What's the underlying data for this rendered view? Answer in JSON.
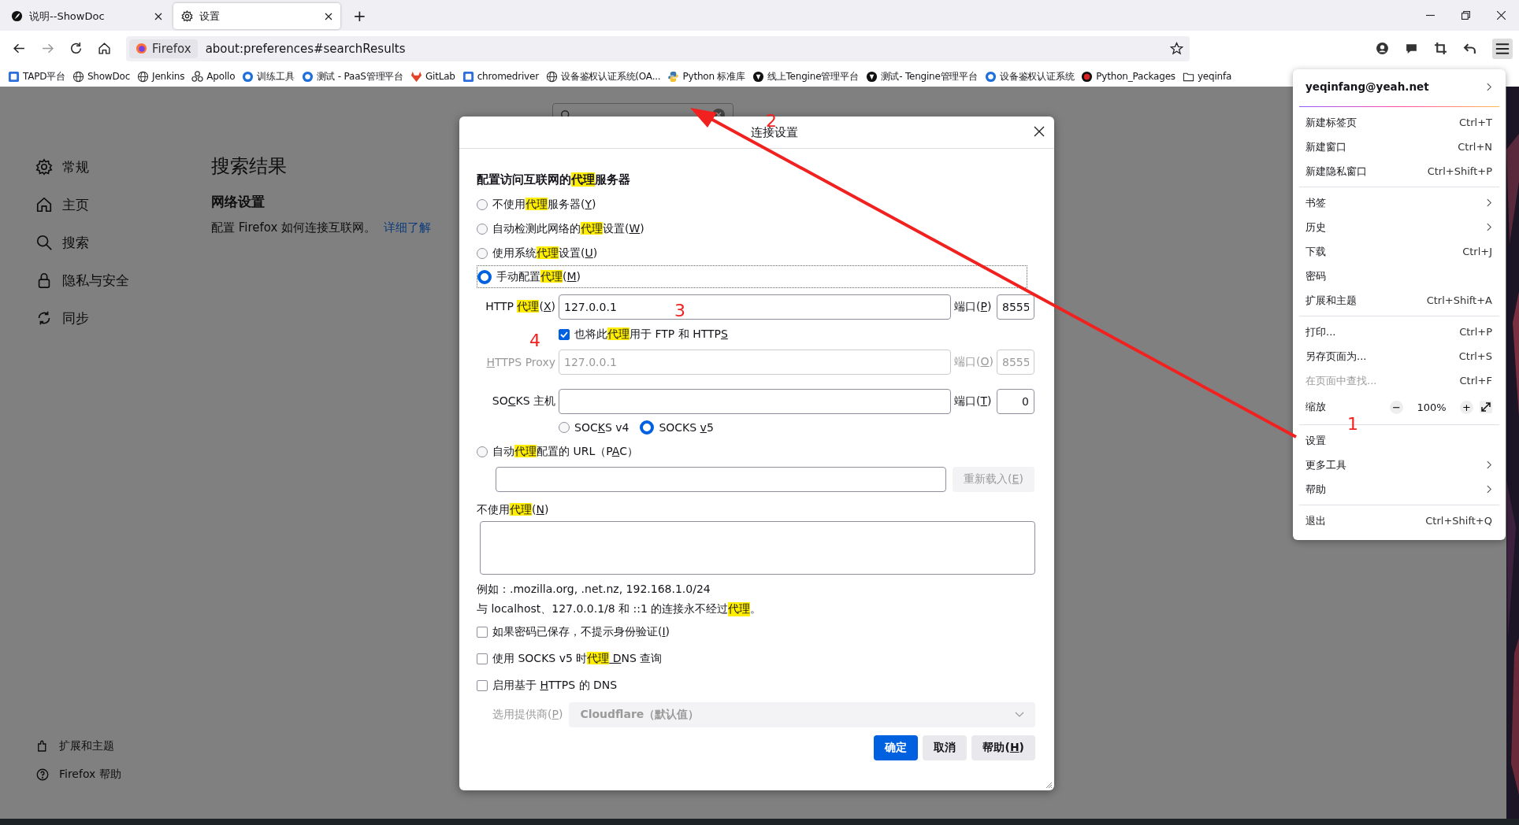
{
  "browser_tabs": [
    {
      "title": "说明--ShowDoc",
      "selected": false
    },
    {
      "title": "设置",
      "selected": true
    }
  ],
  "new_tab_button": "+",
  "address_bar": {
    "identity": "Firefox",
    "url": "about:preferences#searchResults"
  },
  "bookmarks": [
    {
      "label": "TAPD平台",
      "kind": "square"
    },
    {
      "label": "ShowDoc",
      "kind": "globe"
    },
    {
      "label": "Jenkins",
      "kind": "globe"
    },
    {
      "label": "Apollo",
      "kind": "tree"
    },
    {
      "label": "训练工具",
      "kind": "blue-badge"
    },
    {
      "label": "测试 - PaaS管理平台",
      "kind": "blue-badge"
    },
    {
      "label": "GitLab",
      "kind": "fox"
    },
    {
      "label": "chromedriver",
      "kind": "square"
    },
    {
      "label": "设备鉴权认证系统(OA...",
      "kind": "globe"
    },
    {
      "label": "Python 标准库",
      "kind": "python"
    },
    {
      "label": "线上Tengine管理平台",
      "kind": "dark-badge"
    },
    {
      "label": "测试- Tengine管理平台",
      "kind": "dark-badge"
    },
    {
      "label": "设备鉴权认证系统",
      "kind": "blue-badge"
    },
    {
      "label": "Python_Packages",
      "kind": "red-badge"
    },
    {
      "label": "yeqinfa",
      "kind": "folder"
    }
  ],
  "sidebar": {
    "items": [
      {
        "label": "常规",
        "kind": "gear"
      },
      {
        "label": "主页",
        "kind": "home"
      },
      {
        "label": "搜索",
        "kind": "search"
      },
      {
        "label": "隐私与安全",
        "kind": "lock"
      },
      {
        "label": "同步",
        "kind": "sync"
      }
    ],
    "footer": [
      {
        "label": "扩展和主题",
        "kind": "puzzle"
      },
      {
        "label": "Firefox 帮助",
        "kind": "help"
      }
    ]
  },
  "search_field": {
    "clear_button": true
  },
  "main": {
    "heading": "搜索结果",
    "section_title": "网络设置",
    "description": "配置 Firefox 如何连接互联网。",
    "link": "详细了解"
  },
  "dialog": {
    "title": "连接设置",
    "heading": [
      {
        "t": "配置访问互联网的"
      },
      {
        "t": "代理",
        "hl": true
      },
      {
        "t": "服务器"
      }
    ],
    "proxy_modes": [
      {
        "selected": false,
        "label": [
          {
            "t": "不使用"
          },
          {
            "t": "代理",
            "hl": true
          },
          {
            "t": "服务器("
          },
          {
            "t": "Y",
            "u": true
          },
          {
            "t": ")"
          }
        ]
      },
      {
        "selected": false,
        "label": [
          {
            "t": "自动检测此网络的"
          },
          {
            "t": "代理",
            "hl": true
          },
          {
            "t": "设置("
          },
          {
            "t": "W",
            "u": true
          },
          {
            "t": ")"
          }
        ]
      },
      {
        "selected": false,
        "label": [
          {
            "t": "使用系统"
          },
          {
            "t": "代理",
            "hl": true
          },
          {
            "t": "设置("
          },
          {
            "t": "U",
            "u": true
          },
          {
            "t": ")"
          }
        ]
      },
      {
        "selected": true,
        "label": [
          {
            "t": "手动配置"
          },
          {
            "t": "代理",
            "hl": true
          },
          {
            "t": "("
          },
          {
            "t": "M",
            "u": true
          },
          {
            "t": ")"
          }
        ]
      },
      {
        "selected": false,
        "label": [
          {
            "t": "自动"
          },
          {
            "t": "代理",
            "hl": true
          },
          {
            "t": "配置的 URL（P"
          },
          {
            "t": "A",
            "u": true
          },
          {
            "t": "C）"
          }
        ]
      }
    ],
    "http": {
      "label": [
        {
          "t": "HTTP "
        },
        {
          "t": "代理",
          "hl": true
        },
        {
          "t": "("
        },
        {
          "t": "X",
          "u": true
        },
        {
          "t": ")"
        }
      ],
      "value": "127.0.0.1",
      "port_label": [
        {
          "t": "端口("
        },
        {
          "t": "P",
          "u": true
        },
        {
          "t": ")"
        }
      ],
      "port": "8555",
      "disabled": false
    },
    "share_proxy": {
      "checked": true,
      "label": [
        {
          "t": "也将此"
        },
        {
          "t": "代理",
          "hl": true
        },
        {
          "t": "用于 FTP 和 HTTP"
        },
        {
          "t": "S",
          "u": true
        }
      ]
    },
    "https": {
      "label": [
        {
          "t": "H",
          "u": true
        },
        {
          "t": "TTPS Proxy"
        }
      ],
      "value": "127.0.0.1",
      "port_label": [
        {
          "t": "端口("
        },
        {
          "t": "O",
          "u": true
        },
        {
          "t": ")"
        }
      ],
      "port": "8555",
      "disabled": true
    },
    "socks": {
      "label": [
        {
          "t": "SO"
        },
        {
          "t": "C",
          "u": true
        },
        {
          "t": "KS 主机"
        }
      ],
      "port_label": [
        {
          "t": "端口("
        },
        {
          "t": "T",
          "u": true
        },
        {
          "t": ")"
        }
      ],
      "port": "0",
      "disabled": false
    },
    "socks_versions": [
      {
        "selected": false,
        "label": [
          {
            "t": "SOC"
          },
          {
            "t": "K",
            "u": true
          },
          {
            "t": "S v4"
          }
        ]
      },
      {
        "selected": true,
        "label": [
          {
            "t": "SOCKS "
          },
          {
            "t": "v",
            "u": true
          },
          {
            "t": "5"
          }
        ]
      }
    ],
    "reload_button": {
      "disabled": true,
      "label": [
        {
          "t": "重新载入("
        },
        {
          "t": "E",
          "u": true
        },
        {
          "t": ")"
        }
      ]
    },
    "no_proxy_label": [
      {
        "t": "不使用"
      },
      {
        "t": "代理",
        "hl": true
      },
      {
        "t": "("
      },
      {
        "t": "N",
        "u": true
      },
      {
        "t": ")"
      }
    ],
    "example": "例如：.mozilla.org, .net.nz, 192.168.1.0/24",
    "note": [
      {
        "t": "与 localhost、127.0.0.1/8 和 ::1 的连接永不经过"
      },
      {
        "t": "代理",
        "hl": true
      },
      {
        "t": "。"
      }
    ],
    "options": [
      {
        "checked": false,
        "label": [
          {
            "t": "如果密码已保存，不提示身份验证("
          },
          {
            "t": "I",
            "u": true
          },
          {
            "t": ")"
          }
        ]
      },
      {
        "checked": false,
        "label": [
          {
            "t": "使用 SOCKS v5 时"
          },
          {
            "t": "代理",
            "hl": true
          },
          {
            "t": " D",
            "u": true
          },
          {
            "t": "NS 查询"
          }
        ]
      },
      {
        "checked": false,
        "label": [
          {
            "t": "启用基于 "
          },
          {
            "t": "H",
            "u": true
          },
          {
            "t": "TTPS 的 DNS"
          }
        ]
      }
    ],
    "provider": {
      "disabled": true,
      "label": [
        {
          "t": "选用提供商("
        },
        {
          "t": "P",
          "u": true
        },
        {
          "t": ")"
        }
      ],
      "value": "Cloudflare（默认值）"
    },
    "buttons": [
      {
        "kind": "primary",
        "label": [
          {
            "t": "确定"
          }
        ]
      },
      {
        "kind": "default",
        "label": [
          {
            "t": "取消"
          }
        ]
      },
      {
        "kind": "default",
        "label": [
          {
            "t": "帮助("
          },
          {
            "t": "H",
            "u": true
          },
          {
            "t": ")"
          }
        ]
      }
    ]
  },
  "menu": {
    "account": "yeqinfang@yeah.net",
    "items": [
      {
        "kind": "separator"
      },
      {
        "kind": "item",
        "label": "新建标签页",
        "shortcut": "Ctrl+T",
        "submenu": false,
        "disabled": false
      },
      {
        "kind": "item",
        "label": "新建窗口",
        "shortcut": "Ctrl+N",
        "submenu": false,
        "disabled": false
      },
      {
        "kind": "item",
        "label": "新建隐私窗口",
        "shortcut": "Ctrl+Shift+P",
        "submenu": false,
        "disabled": false
      },
      {
        "kind": "separator"
      },
      {
        "kind": "item",
        "label": "书签",
        "submenu": true,
        "disabled": false
      },
      {
        "kind": "item",
        "label": "历史",
        "submenu": true,
        "disabled": false
      },
      {
        "kind": "item",
        "label": "下载",
        "shortcut": "Ctrl+J",
        "submenu": false,
        "disabled": false
      },
      {
        "kind": "item",
        "label": "密码",
        "submenu": false,
        "disabled": false
      },
      {
        "kind": "item",
        "label": "扩展和主题",
        "shortcut": "Ctrl+Shift+A",
        "submenu": false,
        "disabled": false
      },
      {
        "kind": "separator"
      },
      {
        "kind": "item",
        "label": "打印...",
        "shortcut": "Ctrl+P",
        "submenu": false,
        "disabled": false
      },
      {
        "kind": "item",
        "label": "另存页面为...",
        "shortcut": "Ctrl+S",
        "submenu": false,
        "disabled": false
      },
      {
        "kind": "item",
        "label": "在页面中查找...",
        "shortcut": "Ctrl+F",
        "submenu": false,
        "disabled": true
      },
      {
        "kind": "zoom",
        "label": "缩放",
        "minus": "−",
        "value": "100%",
        "plus": "+"
      },
      {
        "kind": "separator"
      },
      {
        "kind": "item",
        "label": "设置",
        "submenu": false,
        "disabled": false
      },
      {
        "kind": "item",
        "label": "更多工具",
        "submenu": true,
        "disabled": false
      },
      {
        "kind": "item",
        "label": "帮助",
        "submenu": true,
        "disabled": false
      },
      {
        "kind": "separator"
      },
      {
        "kind": "item",
        "label": "退出",
        "shortcut": "Ctrl+Shift+Q",
        "submenu": false,
        "disabled": false
      }
    ]
  },
  "annotations": [
    "1",
    "2",
    "3",
    "4"
  ]
}
